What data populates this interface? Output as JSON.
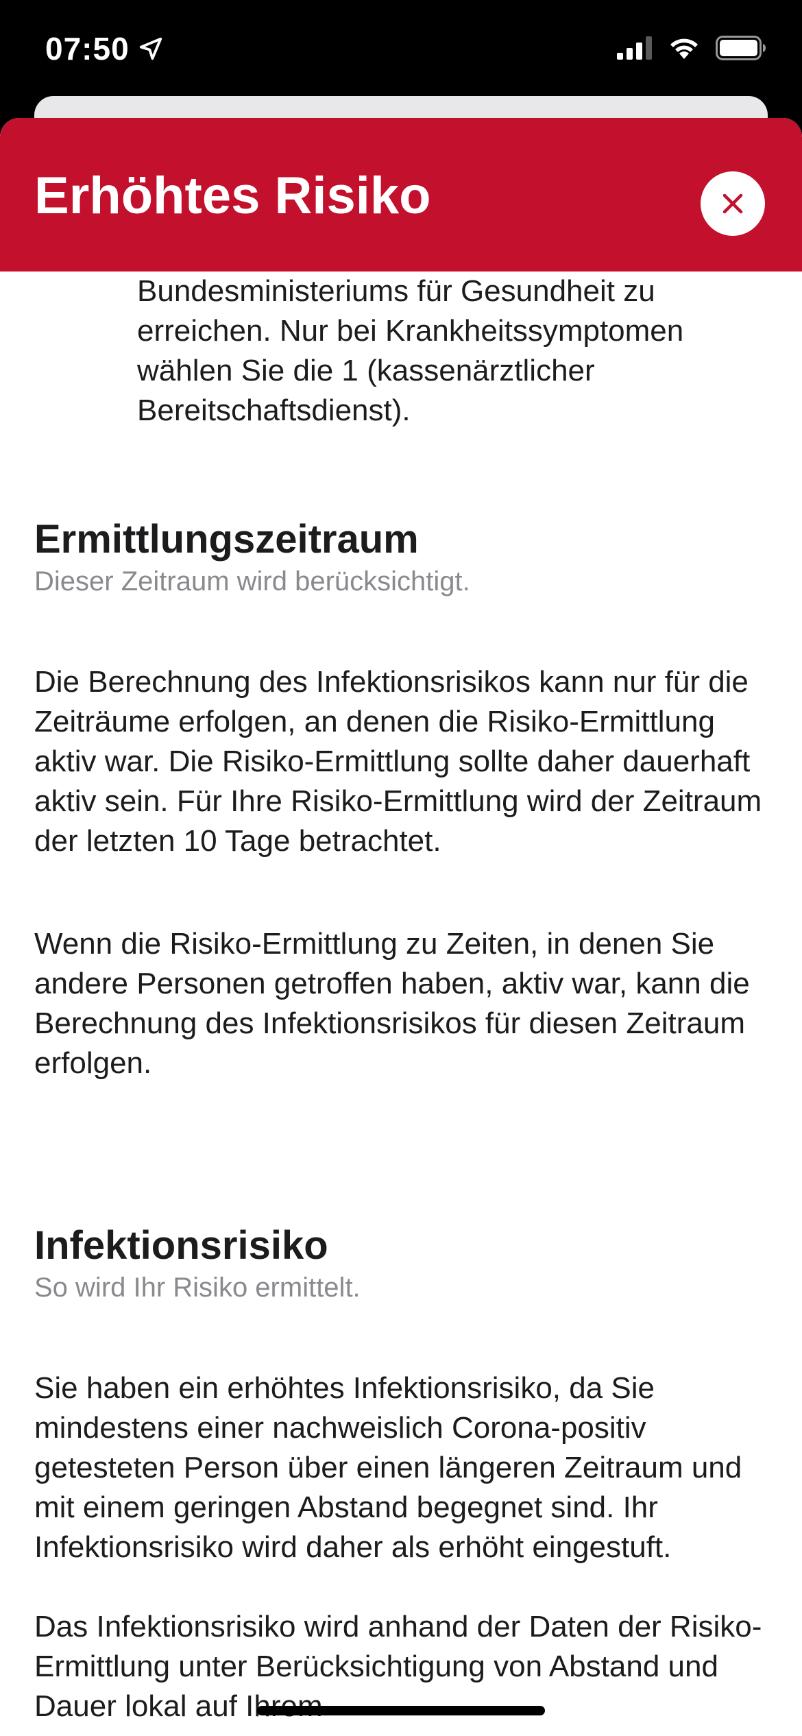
{
  "status_bar": {
    "time": "07:50",
    "icons": [
      "location-arrow-icon",
      "cellular-signal-icon",
      "wifi-icon",
      "battery-icon"
    ]
  },
  "sheet": {
    "title": "Erhöhtes Risiko",
    "close_icon": "close-icon",
    "header_color": "#c2102d"
  },
  "content": {
    "intro_text": "Bundesministeriums für Gesundheit zu erreichen. Nur bei Krankheitssymptomen wählen Sie die 1 (kassenärztlicher Bereitschaftsdienst).",
    "sections": [
      {
        "title": "Ermittlungszeitraum",
        "subtitle": "Dieser Zeitraum wird berücksichtigt.",
        "paragraphs": [
          "Die Berechnung des Infektionsrisikos kann nur für die Zeiträume erfolgen, an denen die Risiko-Ermittlung aktiv war. Die Risiko-Ermittlung sollte daher dauerhaft aktiv sein. Für Ihre Risiko-Ermittlung wird der Zeitraum der letzten 10 Tage betrachtet.",
          "Wenn die Risiko-Ermittlung zu Zeiten, in denen Sie andere Personen getroffen haben, aktiv war, kann die Berechnung des Infektionsrisikos für diesen Zeitraum erfolgen."
        ]
      },
      {
        "title": "Infektionsrisiko",
        "subtitle": "So wird Ihr Risiko ermittelt.",
        "paragraphs": [
          "Sie haben ein erhöhtes Infektionsrisiko, da Sie mindestens einer nachweislich Corona-positiv getesteten Person über einen längeren Zeitraum und mit einem geringen Abstand begegnet sind. Ihr Infektionsrisiko wird daher als erhöht eingestuft.",
          "Das Infektionsrisiko wird anhand der Daten der Risiko-Ermittlung unter Berücksichtigung von Abstand und Dauer lokal auf Ihrem"
        ]
      }
    ]
  }
}
